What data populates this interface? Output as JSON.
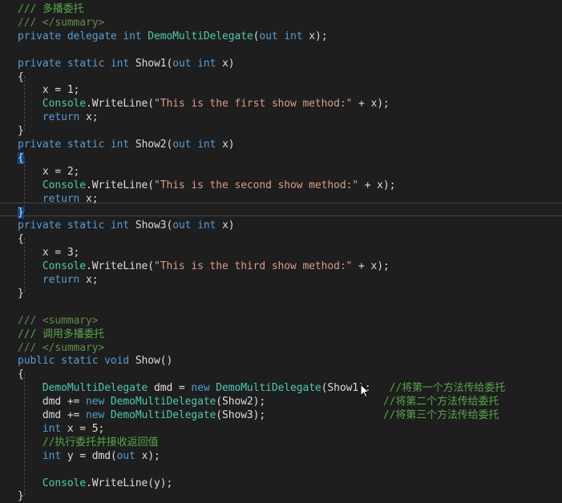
{
  "editor": {
    "lines": [
      [
        {
          "t": "/// 多播委托",
          "c": "cm"
        }
      ],
      [
        {
          "t": "/// </summary>",
          "c": "xml"
        }
      ],
      [
        {
          "t": "private ",
          "c": "kw"
        },
        {
          "t": "delegate ",
          "c": "kw"
        },
        {
          "t": "int ",
          "c": "kw"
        },
        {
          "t": "DemoMultiDelegate",
          "c": "ty"
        },
        {
          "t": "(",
          "c": ""
        },
        {
          "t": "out ",
          "c": "kw"
        },
        {
          "t": "int ",
          "c": "kw"
        },
        {
          "t": "x);",
          "c": ""
        }
      ],
      [],
      [
        {
          "t": "private ",
          "c": "kw"
        },
        {
          "t": "static ",
          "c": "kw"
        },
        {
          "t": "int ",
          "c": "kw"
        },
        {
          "t": "Show1(",
          "c": ""
        },
        {
          "t": "out ",
          "c": "kw"
        },
        {
          "t": "int ",
          "c": "kw"
        },
        {
          "t": "x)",
          "c": ""
        }
      ],
      [
        {
          "t": "{",
          "c": ""
        }
      ],
      [
        {
          "t": "    x = 1;",
          "c": ""
        }
      ],
      [
        {
          "t": "    ",
          "c": ""
        },
        {
          "t": "Console",
          "c": "ty"
        },
        {
          "t": ".WriteLine(",
          "c": ""
        },
        {
          "t": "\"This is the first show method:\"",
          "c": "str"
        },
        {
          "t": " + x);",
          "c": ""
        }
      ],
      [
        {
          "t": "    ",
          "c": ""
        },
        {
          "t": "return ",
          "c": "kw"
        },
        {
          "t": "x;",
          "c": ""
        }
      ],
      [
        {
          "t": "}",
          "c": ""
        }
      ],
      [
        {
          "t": "private ",
          "c": "kw"
        },
        {
          "t": "static ",
          "c": "kw"
        },
        {
          "t": "int ",
          "c": "kw"
        },
        {
          "t": "Show2(",
          "c": ""
        },
        {
          "t": "out ",
          "c": "kw"
        },
        {
          "t": "int ",
          "c": "kw"
        },
        {
          "t": "x)",
          "c": ""
        }
      ],
      [
        {
          "t": "{",
          "c": "brace"
        }
      ],
      [
        {
          "t": "    x = 2;",
          "c": ""
        }
      ],
      [
        {
          "t": "    ",
          "c": ""
        },
        {
          "t": "Console",
          "c": "ty"
        },
        {
          "t": ".WriteLine(",
          "c": ""
        },
        {
          "t": "\"This is the second show method:\"",
          "c": "str"
        },
        {
          "t": " + x);",
          "c": ""
        }
      ],
      [
        {
          "t": "    ",
          "c": ""
        },
        {
          "t": "return ",
          "c": "kw"
        },
        {
          "t": "x;",
          "c": ""
        }
      ],
      [
        {
          "t": "}",
          "c": "brace"
        }
      ],
      [
        {
          "t": "private ",
          "c": "kw"
        },
        {
          "t": "static ",
          "c": "kw"
        },
        {
          "t": "int ",
          "c": "kw"
        },
        {
          "t": "Show3(",
          "c": ""
        },
        {
          "t": "out ",
          "c": "kw"
        },
        {
          "t": "int ",
          "c": "kw"
        },
        {
          "t": "x)",
          "c": ""
        }
      ],
      [
        {
          "t": "{",
          "c": ""
        }
      ],
      [
        {
          "t": "    x = 3;",
          "c": ""
        }
      ],
      [
        {
          "t": "    ",
          "c": ""
        },
        {
          "t": "Console",
          "c": "ty"
        },
        {
          "t": ".WriteLine(",
          "c": ""
        },
        {
          "t": "\"This is the third show method:\"",
          "c": "str"
        },
        {
          "t": " + x);",
          "c": ""
        }
      ],
      [
        {
          "t": "    ",
          "c": ""
        },
        {
          "t": "return ",
          "c": "kw"
        },
        {
          "t": "x;",
          "c": ""
        }
      ],
      [
        {
          "t": "}",
          "c": ""
        }
      ],
      [],
      [
        {
          "t": "/// <summary>",
          "c": "xml"
        }
      ],
      [
        {
          "t": "/// 调用多播委托",
          "c": "cm"
        }
      ],
      [
        {
          "t": "/// </summary>",
          "c": "xml"
        }
      ],
      [
        {
          "t": "public ",
          "c": "kw"
        },
        {
          "t": "static ",
          "c": "kw"
        },
        {
          "t": "void ",
          "c": "kw"
        },
        {
          "t": "Show()",
          "c": ""
        }
      ],
      [
        {
          "t": "{",
          "c": ""
        }
      ],
      [
        {
          "t": "    ",
          "c": ""
        },
        {
          "t": "DemoMultiDelegate",
          "c": "ty"
        },
        {
          "t": " dmd = ",
          "c": ""
        },
        {
          "t": "new ",
          "c": "kw"
        },
        {
          "t": "DemoMultiDelegate",
          "c": "ty"
        },
        {
          "t": "(Show1);   ",
          "c": ""
        },
        {
          "t": "//将第一个方法传给委托",
          "c": "cm"
        }
      ],
      [
        {
          "t": "    dmd += ",
          "c": ""
        },
        {
          "t": "new ",
          "c": "kw"
        },
        {
          "t": "DemoMultiDelegate",
          "c": "ty"
        },
        {
          "t": "(Show2);                   ",
          "c": ""
        },
        {
          "t": "//将第二个方法传给委托",
          "c": "cm"
        }
      ],
      [
        {
          "t": "    dmd += ",
          "c": ""
        },
        {
          "t": "new ",
          "c": "kw"
        },
        {
          "t": "DemoMultiDelegate",
          "c": "ty"
        },
        {
          "t": "(Show3);                   ",
          "c": ""
        },
        {
          "t": "//将第三个方法传给委托",
          "c": "cm"
        }
      ],
      [
        {
          "t": "    ",
          "c": ""
        },
        {
          "t": "int ",
          "c": "kw"
        },
        {
          "t": "x = 5;",
          "c": ""
        }
      ],
      [
        {
          "t": "    ",
          "c": ""
        },
        {
          "t": "//执行委托并接收返回值",
          "c": "cm"
        }
      ],
      [
        {
          "t": "    ",
          "c": ""
        },
        {
          "t": "int ",
          "c": "kw"
        },
        {
          "t": "y = dmd(",
          "c": ""
        },
        {
          "t": "out ",
          "c": "kw"
        },
        {
          "t": "x);",
          "c": ""
        }
      ],
      [],
      [
        {
          "t": "    ",
          "c": ""
        },
        {
          "t": "Console",
          "c": "ty"
        },
        {
          "t": ".WriteLine(y);",
          "c": ""
        }
      ],
      [
        {
          "t": "}",
          "c": ""
        }
      ]
    ]
  }
}
